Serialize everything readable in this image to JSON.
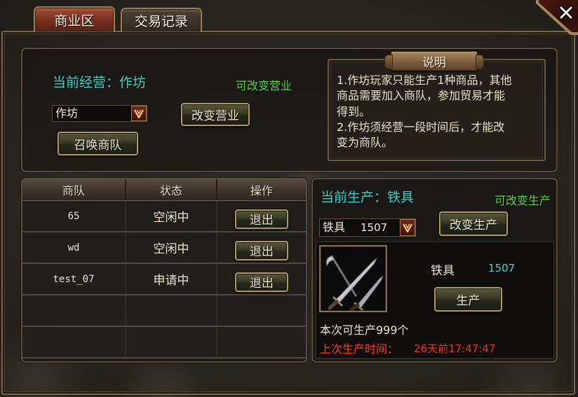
{
  "tabs": [
    {
      "label": "商业区",
      "active": true
    },
    {
      "label": "交易记录",
      "active": false
    }
  ],
  "icons": {
    "close": "close-icon",
    "dropdown": "chevron-down-icon",
    "item": "iron-tools-icon"
  },
  "business": {
    "current_label": "当前经营：作坊",
    "status_text": "可改变营业",
    "select_value": "作坊",
    "change_button": "改变营业",
    "summon_button": "召唤商队"
  },
  "notice": {
    "title": "说明",
    "lines": [
      "1.作坊玩家只能生产1种商品，其他",
      "商品需要加入商队，参加贸易才能",
      "得到。",
      "2.作坊须经营一段时间后，才能改",
      "变为商队。"
    ]
  },
  "caravan_table": {
    "headers": [
      "商队",
      "状态",
      "操作"
    ],
    "rows": [
      {
        "name": "65",
        "status": "空闲中",
        "action": "退出"
      },
      {
        "name": "wd",
        "status": "空闲中",
        "action": "退出"
      },
      {
        "name": "test_07",
        "status": "申请中",
        "action": "退出"
      }
    ]
  },
  "production": {
    "current_label": "当前生产：铁具",
    "status_text": "可改变生产",
    "select_item": "铁具",
    "select_count": "1507",
    "change_button": "改变生产",
    "item_name": "铁具",
    "item_count": "1507",
    "produce_button": "生产",
    "capacity_text": "本次可生产999个",
    "last_time_label": "上次生产时间：",
    "last_time_value": "26天前17:47:47"
  },
  "colors": {
    "teal": "#3fd6d0",
    "green": "#5fd84a",
    "red": "#ff3a24",
    "text": "#eadfc4",
    "gold": "#a88c58",
    "tab_active": "#7e3424"
  }
}
